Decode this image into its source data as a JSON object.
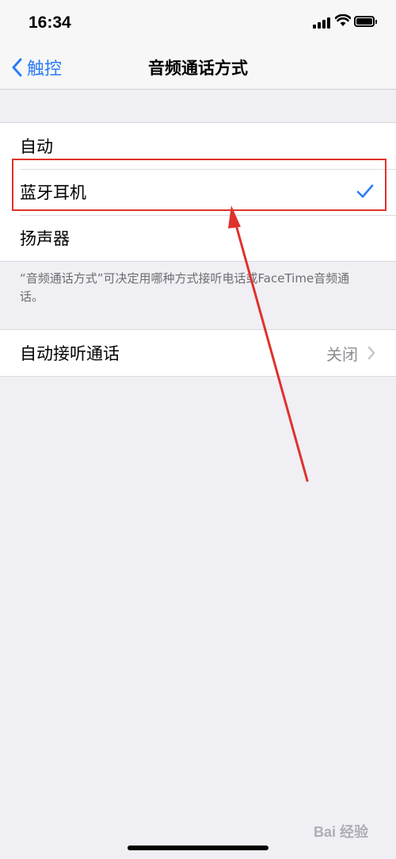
{
  "status_bar": {
    "time": "16:34"
  },
  "nav": {
    "back_label": "触控",
    "title": "音频通话方式"
  },
  "routing_options": [
    {
      "label": "自动",
      "selected": false
    },
    {
      "label": "蓝牙耳机",
      "selected": true
    },
    {
      "label": "扬声器",
      "selected": false
    }
  ],
  "footer_note": "“音频通话方式”可决定用哪种方式接听电话或FaceTime音频通话。",
  "auto_answer": {
    "label": "自动接听通话",
    "value": "关闭"
  },
  "watermark": "Bai 经验",
  "colors": {
    "accent": "#2b7cf6",
    "annotation": "#e0312c",
    "background": "#efeff4"
  }
}
